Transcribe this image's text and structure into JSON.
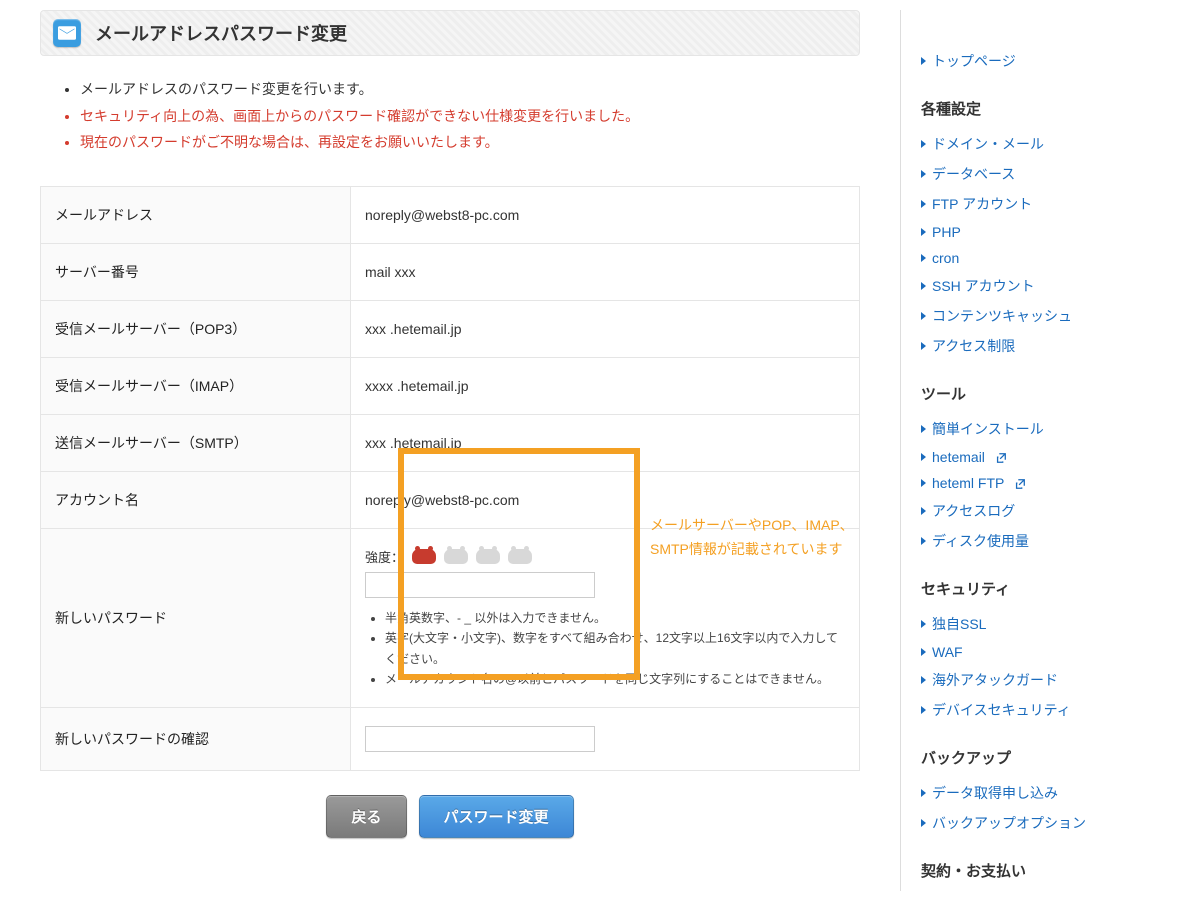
{
  "page_title": "メールアドレスパスワード変更",
  "notices": [
    {
      "text": "メールアドレスのパスワード変更を行います。",
      "red": false
    },
    {
      "text": "セキュリティ向上の為、画面上からのパスワード確認ができない仕様変更を行いました。",
      "red": true
    },
    {
      "text": "現在のパスワードがご不明な場合は、再設定をお願いいたします。",
      "red": true
    }
  ],
  "highlight_note_line1": "メールサーバーやPOP、IMAP、",
  "highlight_note_line2": "SMTP情報が記載されています",
  "fields": {
    "email_label": "メールアドレス",
    "email_value": "noreply@webst8-pc.com",
    "server_number_label": "サーバー番号",
    "server_number_value": "mail xxx",
    "pop3_label": "受信メールサーバー（POP3）",
    "pop3_value": "xxx .hetemail.jp",
    "imap_label": "受信メールサーバー（IMAP）",
    "imap_value": "xxxx .hetemail.jp",
    "smtp_label": "送信メールサーバー（SMTP）",
    "smtp_value": "xxx .hetemail.jp",
    "account_label": "アカウント名",
    "account_value": "noreply@webst8-pc.com",
    "newpw_label": "新しいパスワード",
    "confirmpw_label": "新しいパスワードの確認",
    "strength_label": "強度：",
    "pw_notes": [
      "半角英数字、- _ 以外は入力できません。",
      "英字(大文字・小文字)、数字をすべて組み合わせ、12文字以上16文字以内で入力してください。",
      "メールアカウント名の@以前とパスワードを同じ文字列にすることはできません。"
    ]
  },
  "buttons": {
    "back": "戻る",
    "submit": "パスワード変更"
  },
  "sidebar": {
    "top_link": "トップページ",
    "sections": [
      {
        "title": "各種設定",
        "items": [
          {
            "label": "ドメイン・メール"
          },
          {
            "label": "データベース"
          },
          {
            "label": "FTP アカウント"
          },
          {
            "label": "PHP"
          },
          {
            "label": "cron"
          },
          {
            "label": "SSH アカウント"
          },
          {
            "label": "コンテンツキャッシュ"
          },
          {
            "label": "アクセス制限"
          }
        ]
      },
      {
        "title": "ツール",
        "items": [
          {
            "label": "簡単インストール"
          },
          {
            "label": "hetemail",
            "external": true
          },
          {
            "label": "heteml FTP",
            "external": true
          },
          {
            "label": "アクセスログ"
          },
          {
            "label": "ディスク使用量"
          }
        ]
      },
      {
        "title": "セキュリティ",
        "items": [
          {
            "label": "独自SSL"
          },
          {
            "label": "WAF"
          },
          {
            "label": "海外アタックガード"
          },
          {
            "label": "デバイスセキュリティ"
          }
        ]
      },
      {
        "title": "バックアップ",
        "items": [
          {
            "label": "データ取得申し込み"
          },
          {
            "label": "バックアップオプション"
          }
        ]
      },
      {
        "title": "契約・お支払い",
        "items": []
      }
    ]
  }
}
